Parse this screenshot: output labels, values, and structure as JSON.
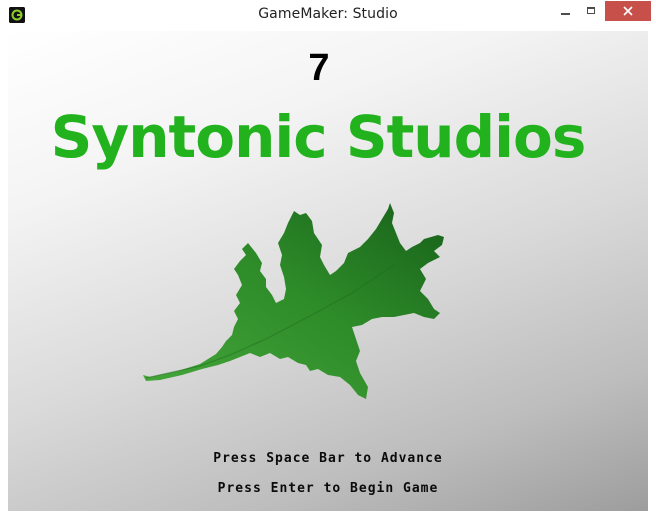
{
  "window": {
    "title": "GameMaker: Studio",
    "icon": "gamemaker-icon",
    "controls": [
      "minimize-icon",
      "maximize-icon",
      "close-icon"
    ],
    "close_color": "#c7504b"
  },
  "game": {
    "counter": "7",
    "studio_name": "Syntonic Studios",
    "studio_name_color": "#22b21d",
    "logo": "oak-leaf",
    "leaf_color": "#2e8a2a",
    "prompts": {
      "advance": "Press Space Bar to Advance",
      "begin": "Press Enter to Begin Game"
    }
  }
}
